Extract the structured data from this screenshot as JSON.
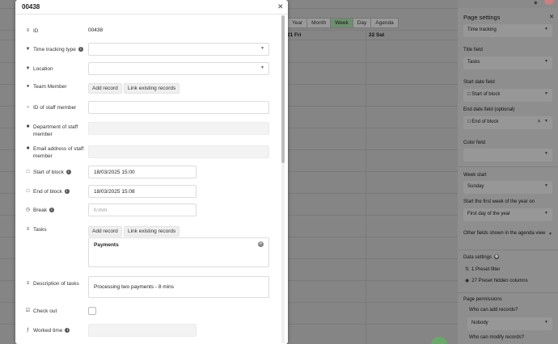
{
  "background": {
    "view_buttons": [
      "Year",
      "Month",
      "Week",
      "Day",
      "Agenda"
    ],
    "active_view": "Week",
    "day_headers": [
      "21 Fri",
      "22 Sat"
    ]
  },
  "modal": {
    "title": "00438",
    "fields": {
      "id": {
        "label": "ID",
        "value": "00438"
      },
      "time_tracking_type": {
        "label": "Time tracking type"
      },
      "location": {
        "label": "Location"
      },
      "team_member": {
        "label": "Team Member",
        "add_label": "Add record",
        "link_label": "Link existing records"
      },
      "staff_id": {
        "label": "ID of staff member"
      },
      "department": {
        "label": "Department of staff member"
      },
      "email": {
        "label": "Email address of staff member"
      },
      "start_of_block": {
        "label": "Start of block",
        "value": "18/03/2025 15:00"
      },
      "end_of_block": {
        "label": "End of block",
        "value": "18/03/2025 15:08"
      },
      "break": {
        "label": "Break",
        "placeholder": "h:mm"
      },
      "tasks": {
        "label": "Tasks",
        "add_label": "Add record",
        "link_label": "Link existing records",
        "item": "Payments"
      },
      "description": {
        "label": "Description of tasks",
        "value": "Processing two payments - 8 mins"
      },
      "check_out": {
        "label": "Check out"
      },
      "worked_time": {
        "label": "Worked time"
      }
    }
  },
  "panel": {
    "title": "Page settings",
    "source_select": "Time tracking",
    "title_field": {
      "label": "Title field",
      "value": "Tasks"
    },
    "start_date_field": {
      "label": "Start date field",
      "value": "Start of block"
    },
    "end_date_field": {
      "label": "End date field (optional)",
      "value": "End of block"
    },
    "color_field": {
      "label": "Color field"
    },
    "week_start": {
      "label": "Week start",
      "value": "Sunday"
    },
    "first_week": {
      "label": "Start the first week of the year on",
      "value": "First day of the year"
    },
    "other_fields": {
      "label": "Other fields shown in the agenda view"
    },
    "data_settings": {
      "label": "Data settings",
      "filter": "1 Preset filter",
      "hidden": "27 Preset hidden columns"
    },
    "permissions": {
      "label": "Page permissions",
      "add_label": "Who can add records?",
      "add_value": "Nobody",
      "modify_label": "Who can modify records?"
    }
  }
}
